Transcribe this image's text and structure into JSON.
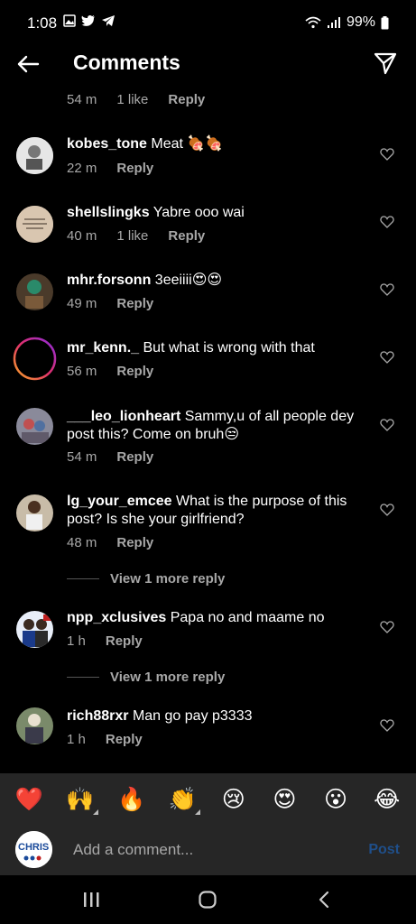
{
  "status": {
    "time": "1:08",
    "battery": "99%"
  },
  "header": {
    "title": "Comments"
  },
  "top_meta": {
    "time": "54 m",
    "likes": "1 like",
    "reply": "Reply"
  },
  "comments": [
    {
      "user": "kobes_tone",
      "text": "Meat 🍖🍖",
      "time": "22 m",
      "likes": "",
      "reply": "Reply"
    },
    {
      "user": "shellslingks",
      "text": "Yabre ooo wai",
      "time": "40 m",
      "likes": "1 like",
      "reply": "Reply"
    },
    {
      "user": "mhr.forsonn",
      "text": "3eeiiii😍😍",
      "time": "49 m",
      "likes": "",
      "reply": "Reply"
    },
    {
      "user": "mr_kenn._",
      "text": "But what is wrong with that",
      "time": "56 m",
      "likes": "",
      "reply": "Reply"
    },
    {
      "user": "___leo_lionheart",
      "text": "Sammy,u of all people dey post this? Come on bruh😒",
      "time": "54 m",
      "likes": "",
      "reply": "Reply"
    },
    {
      "user": "lg_your_emcee",
      "text": "What is the purpose of this post? Is she your girlfriend?",
      "time": "48 m",
      "likes": "",
      "reply": "Reply"
    },
    {
      "user": "npp_xclusives",
      "text": "Papa no and maame no",
      "time": "1 h",
      "likes": "",
      "reply": "Reply"
    },
    {
      "user": "rich88rxr",
      "text": "Man go pay p3333",
      "time": "1 h",
      "likes": "",
      "reply": "Reply"
    }
  ],
  "view_more_1": "View 1 more reply",
  "view_more_2": "View 1 more reply",
  "emojis": [
    "❤️",
    "🙌",
    "🔥",
    "👏",
    "😢",
    "😍",
    "😮",
    "😂"
  ],
  "composer": {
    "placeholder": "Add a comment...",
    "post": "Post",
    "avatar_text": "CHRIS"
  },
  "colors": {
    "background": "#000000",
    "muted": "#a8a8a8",
    "bar": "#262626",
    "post_disabled": "#1f4f8a"
  }
}
